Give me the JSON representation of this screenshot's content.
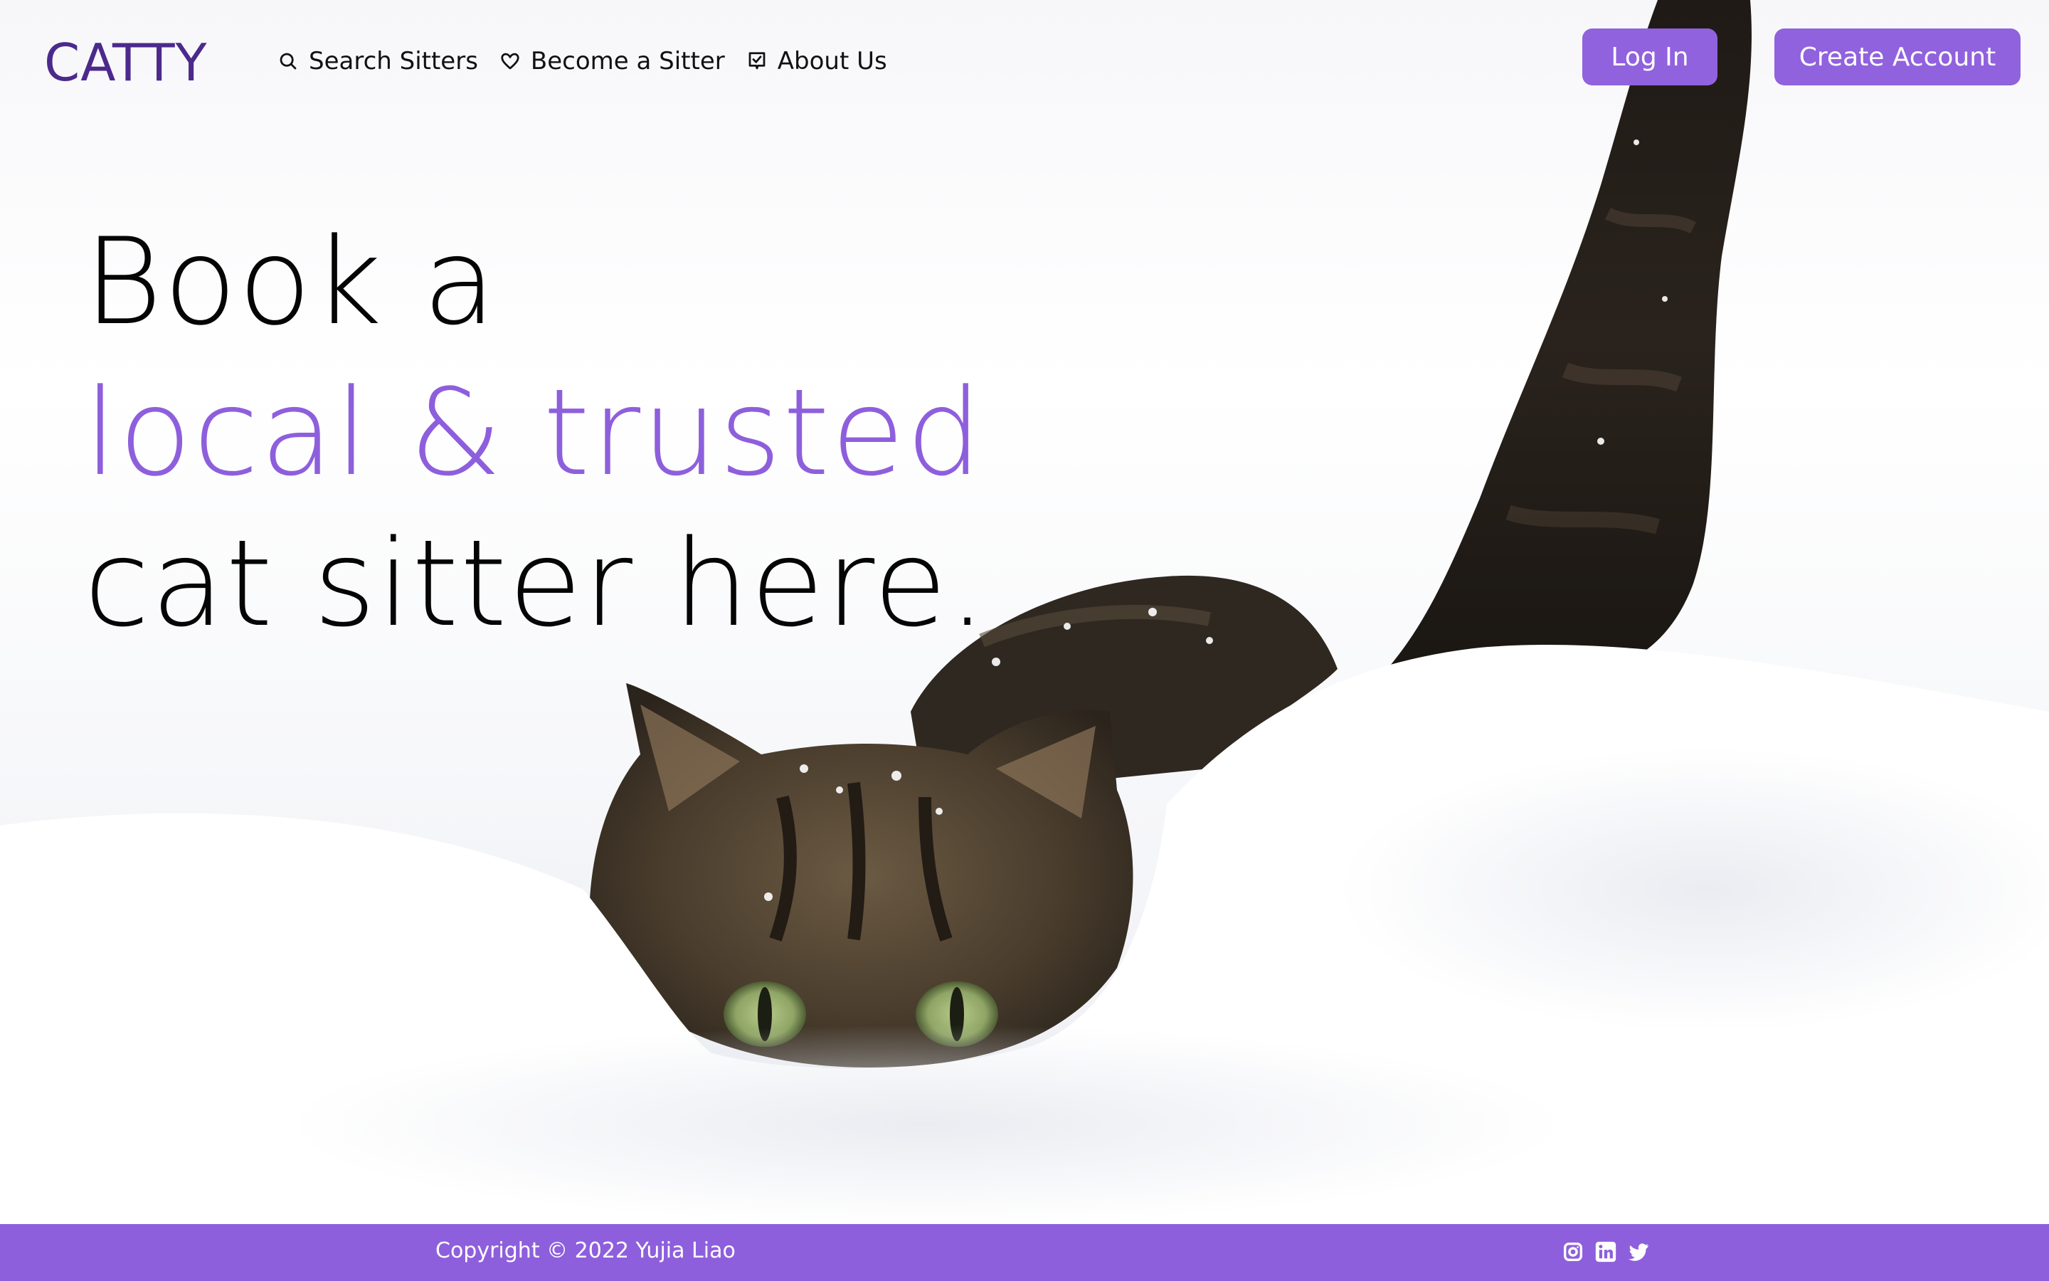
{
  "brand": {
    "name": "CATTY",
    "logo_color": "#4b2a8c",
    "accent_color": "#8e5fdc"
  },
  "nav": {
    "items": [
      {
        "label": "Search Sitters",
        "icon": "search-icon"
      },
      {
        "label": "Become a Sitter",
        "icon": "heart-icon"
      },
      {
        "label": "About Us",
        "icon": "check-box-icon"
      }
    ]
  },
  "auth": {
    "login_label": "Log In",
    "create_label": "Create Account",
    "button_color": "#9162de"
  },
  "hero": {
    "line1": "Book a",
    "line2": "local & trusted",
    "line3": "cat sitter here."
  },
  "footer": {
    "copyright": "Copyright © 2022 Yujia Liao",
    "bar_color": "#8e5fdc",
    "social": [
      "instagram-icon",
      "linkedin-icon",
      "twitter-icon"
    ]
  }
}
